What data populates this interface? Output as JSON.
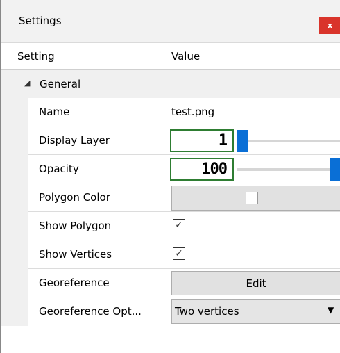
{
  "window": {
    "title": "Settings",
    "close_label": "x"
  },
  "table": {
    "header": {
      "setting": "Setting",
      "value": "Value"
    },
    "group": {
      "label": "General",
      "expander_icon": "triangle-down-icon"
    },
    "rows": {
      "name": {
        "label": "Name",
        "value": "test.png"
      },
      "display_layer": {
        "label": "Display Layer",
        "value": "1",
        "slider_fraction": 0.0
      },
      "opacity": {
        "label": "Opacity",
        "value": "100",
        "slider_fraction": 1.0
      },
      "polygon_color": {
        "label": "Polygon Color",
        "color": "#ffffff"
      },
      "show_polygon": {
        "label": "Show Polygon",
        "checked": true,
        "check_glyph": "✓"
      },
      "show_vertices": {
        "label": "Show Vertices",
        "checked": true,
        "check_glyph": "✓"
      },
      "georeference": {
        "label": "Georeference",
        "button_label": "Edit"
      },
      "georeference_options": {
        "label": "Georeference Opt...",
        "selected": "Two vertices",
        "arrow": "▼"
      }
    }
  },
  "colors": {
    "accent": "#0a6fd6",
    "lcd_border": "#2e7d32",
    "close_bg": "#d9342b"
  }
}
